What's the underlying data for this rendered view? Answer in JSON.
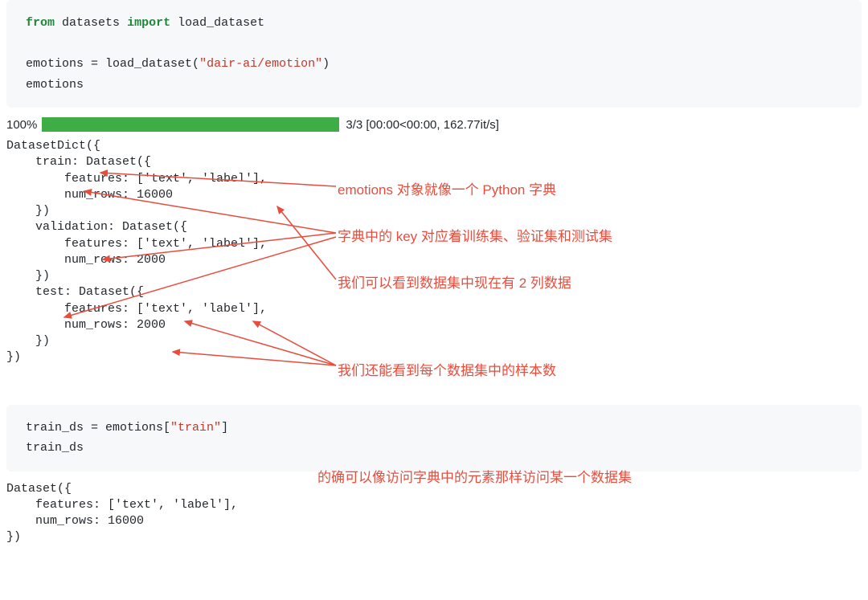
{
  "code1": {
    "from_kw": "from",
    "module": "datasets",
    "import_kw": "import",
    "name": "load_dataset",
    "assign_target": "emotions",
    "eq": " = ",
    "call": "load_dataset(",
    "arg": "\"dair-ai/emotion\"",
    "call_end": ")",
    "echo": "emotions"
  },
  "progress": {
    "pct": "100%",
    "stats": "3/3 [00:00<00:00, 162.77it/s]"
  },
  "output1": "DatasetDict({\n    train: Dataset({\n        features: ['text', 'label'],\n        num_rows: 16000\n    })\n    validation: Dataset({\n        features: ['text', 'label'],\n        num_rows: 2000\n    })\n    test: Dataset({\n        features: ['text', 'label'],\n        num_rows: 2000\n    })\n})",
  "annotations": {
    "a1": "emotions 对象就像一个 Python 字典",
    "a2": "字典中的 key 对应着训练集、验证集和测试集",
    "a3": "我们可以看到数据集中现在有 2 列数据",
    "a4": "我们还能看到每个数据集中的样本数",
    "a5": "的确可以像访问字典中的元素那样访问某一个数据集"
  },
  "code2": {
    "assign_target": "train_ds",
    "eq": " = ",
    "obj": "emotions[",
    "key": "\"train\"",
    "obj_end": "]",
    "echo": "train_ds"
  },
  "output2": "Dataset({\n    features: ['text', 'label'],\n    num_rows: 16000\n})"
}
